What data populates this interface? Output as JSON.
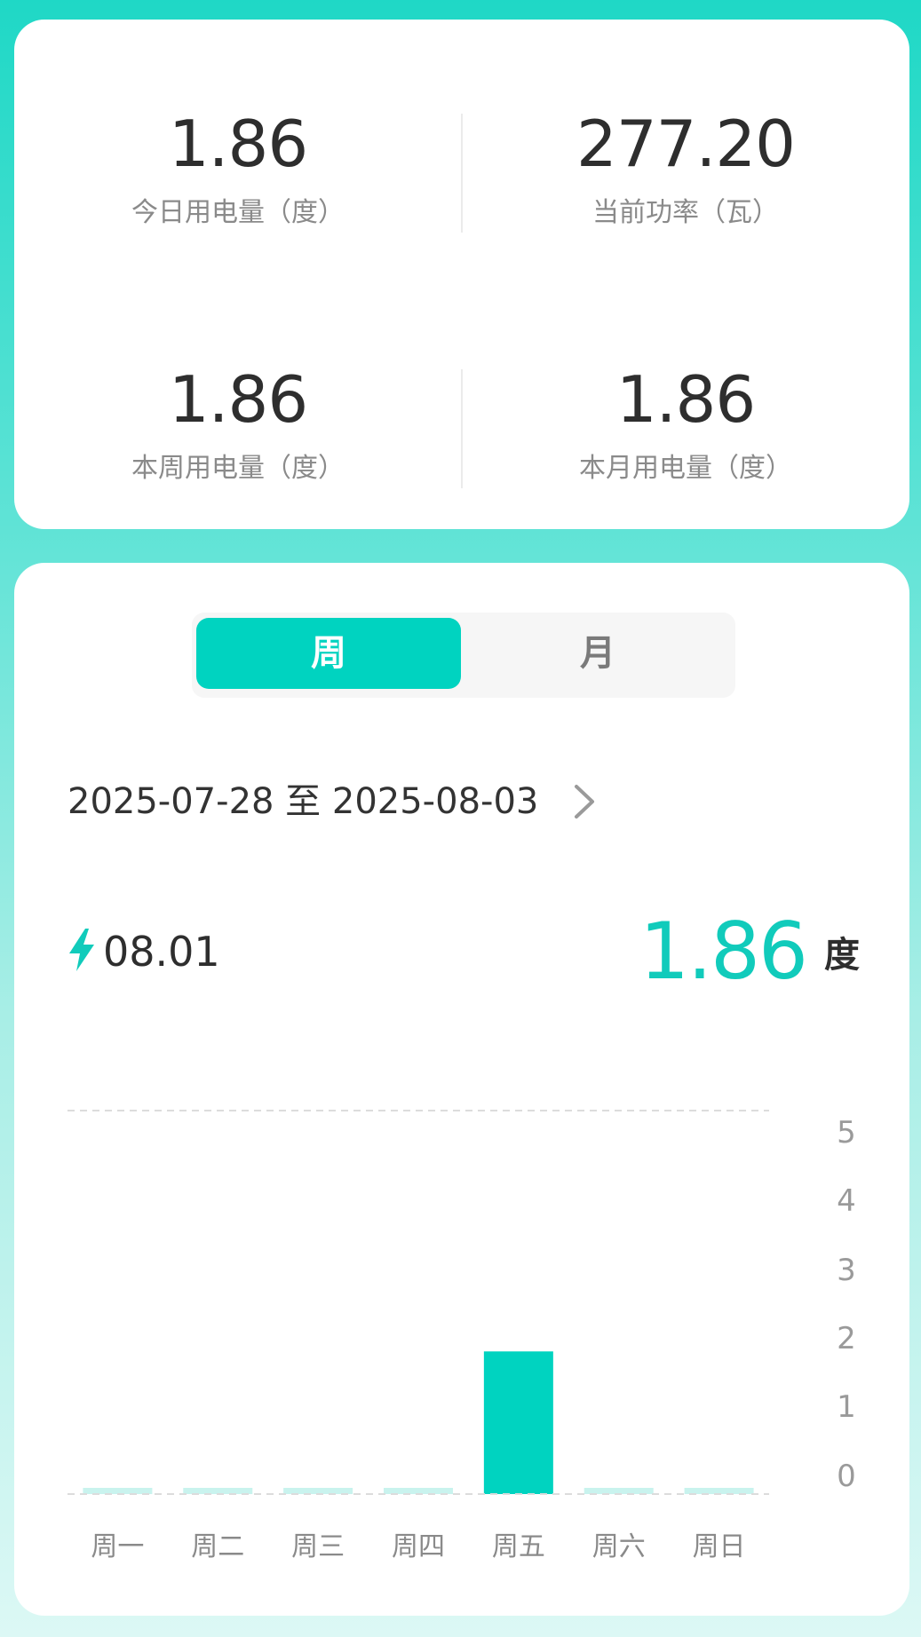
{
  "stats": {
    "today": {
      "value": "1.86",
      "label": "今日用电量（度）"
    },
    "power": {
      "value": "277.20",
      "label": "当前功率（瓦）"
    },
    "week": {
      "value": "1.86",
      "label": "本周用电量（度）"
    },
    "month": {
      "value": "1.86",
      "label": "本月用电量（度）"
    }
  },
  "period_tabs": {
    "week": "周",
    "month": "月",
    "selected": "周"
  },
  "date_range": "2025-07-28 至 2025-08-03",
  "selected_point": {
    "date": "08.01",
    "value": "1.86",
    "unit": "度"
  },
  "colors": {
    "accent": "#00d3c0",
    "accent_text": "#11cbbb",
    "stub": "#c9f3ee",
    "grid": "#dcdcdc"
  },
  "icons": {
    "bolt": "bolt-icon",
    "chevron": "chevron-right-icon"
  },
  "chart_data": {
    "type": "bar",
    "categories": [
      "周一",
      "周二",
      "周三",
      "周四",
      "周五",
      "周六",
      "周日"
    ],
    "values": [
      0,
      0,
      0,
      0,
      1.86,
      0,
      0
    ],
    "ylim": [
      0,
      5
    ],
    "yticks": [
      "5",
      "4",
      "3",
      "2",
      "1",
      "0"
    ],
    "y_axis_side": "right",
    "grid": "dashed top and bottom lines"
  }
}
